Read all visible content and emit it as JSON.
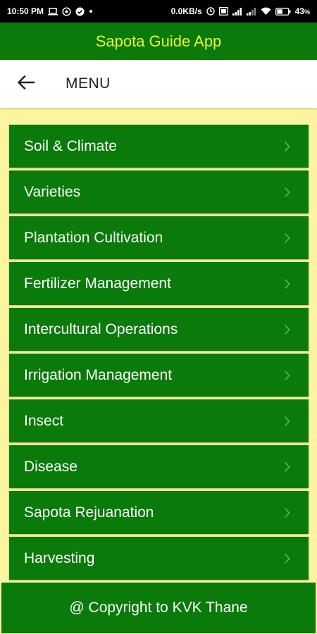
{
  "status_bar": {
    "time": "10:50 PM",
    "network_speed": "0.0KB/s",
    "battery": "43",
    "battery_unit": "%",
    "icons_left": [
      "laptop-icon",
      "whatsapp-icon",
      "check-circle-icon",
      "dot-icon"
    ],
    "icons_right": [
      "alarm-icon",
      "volte-icon",
      "signal-icon",
      "signal-icon",
      "wifi-icon",
      "battery-icon"
    ]
  },
  "app": {
    "title": "Sapota Guide App",
    "title_color": "#e8f43a",
    "primary_color": "#0a7a0a",
    "background_color": "#fbf5a0"
  },
  "header": {
    "back_icon": "arrow-left-icon",
    "title": "MENU"
  },
  "menu": {
    "items": [
      {
        "label": "Soil & Climate"
      },
      {
        "label": "Varieties"
      },
      {
        "label": "Plantation Cultivation"
      },
      {
        "label": "Fertilizer Management"
      },
      {
        "label": "Intercultural Operations"
      },
      {
        "label": "Irrigation Management"
      },
      {
        "label": "Insect"
      },
      {
        "label": "Disease"
      },
      {
        "label": "Sapota Rejuanation"
      },
      {
        "label": "Harvesting"
      }
    ],
    "chevron_icon": "chevron-right-icon"
  },
  "footer": {
    "text": "@ Copyright to KVK Thane"
  }
}
